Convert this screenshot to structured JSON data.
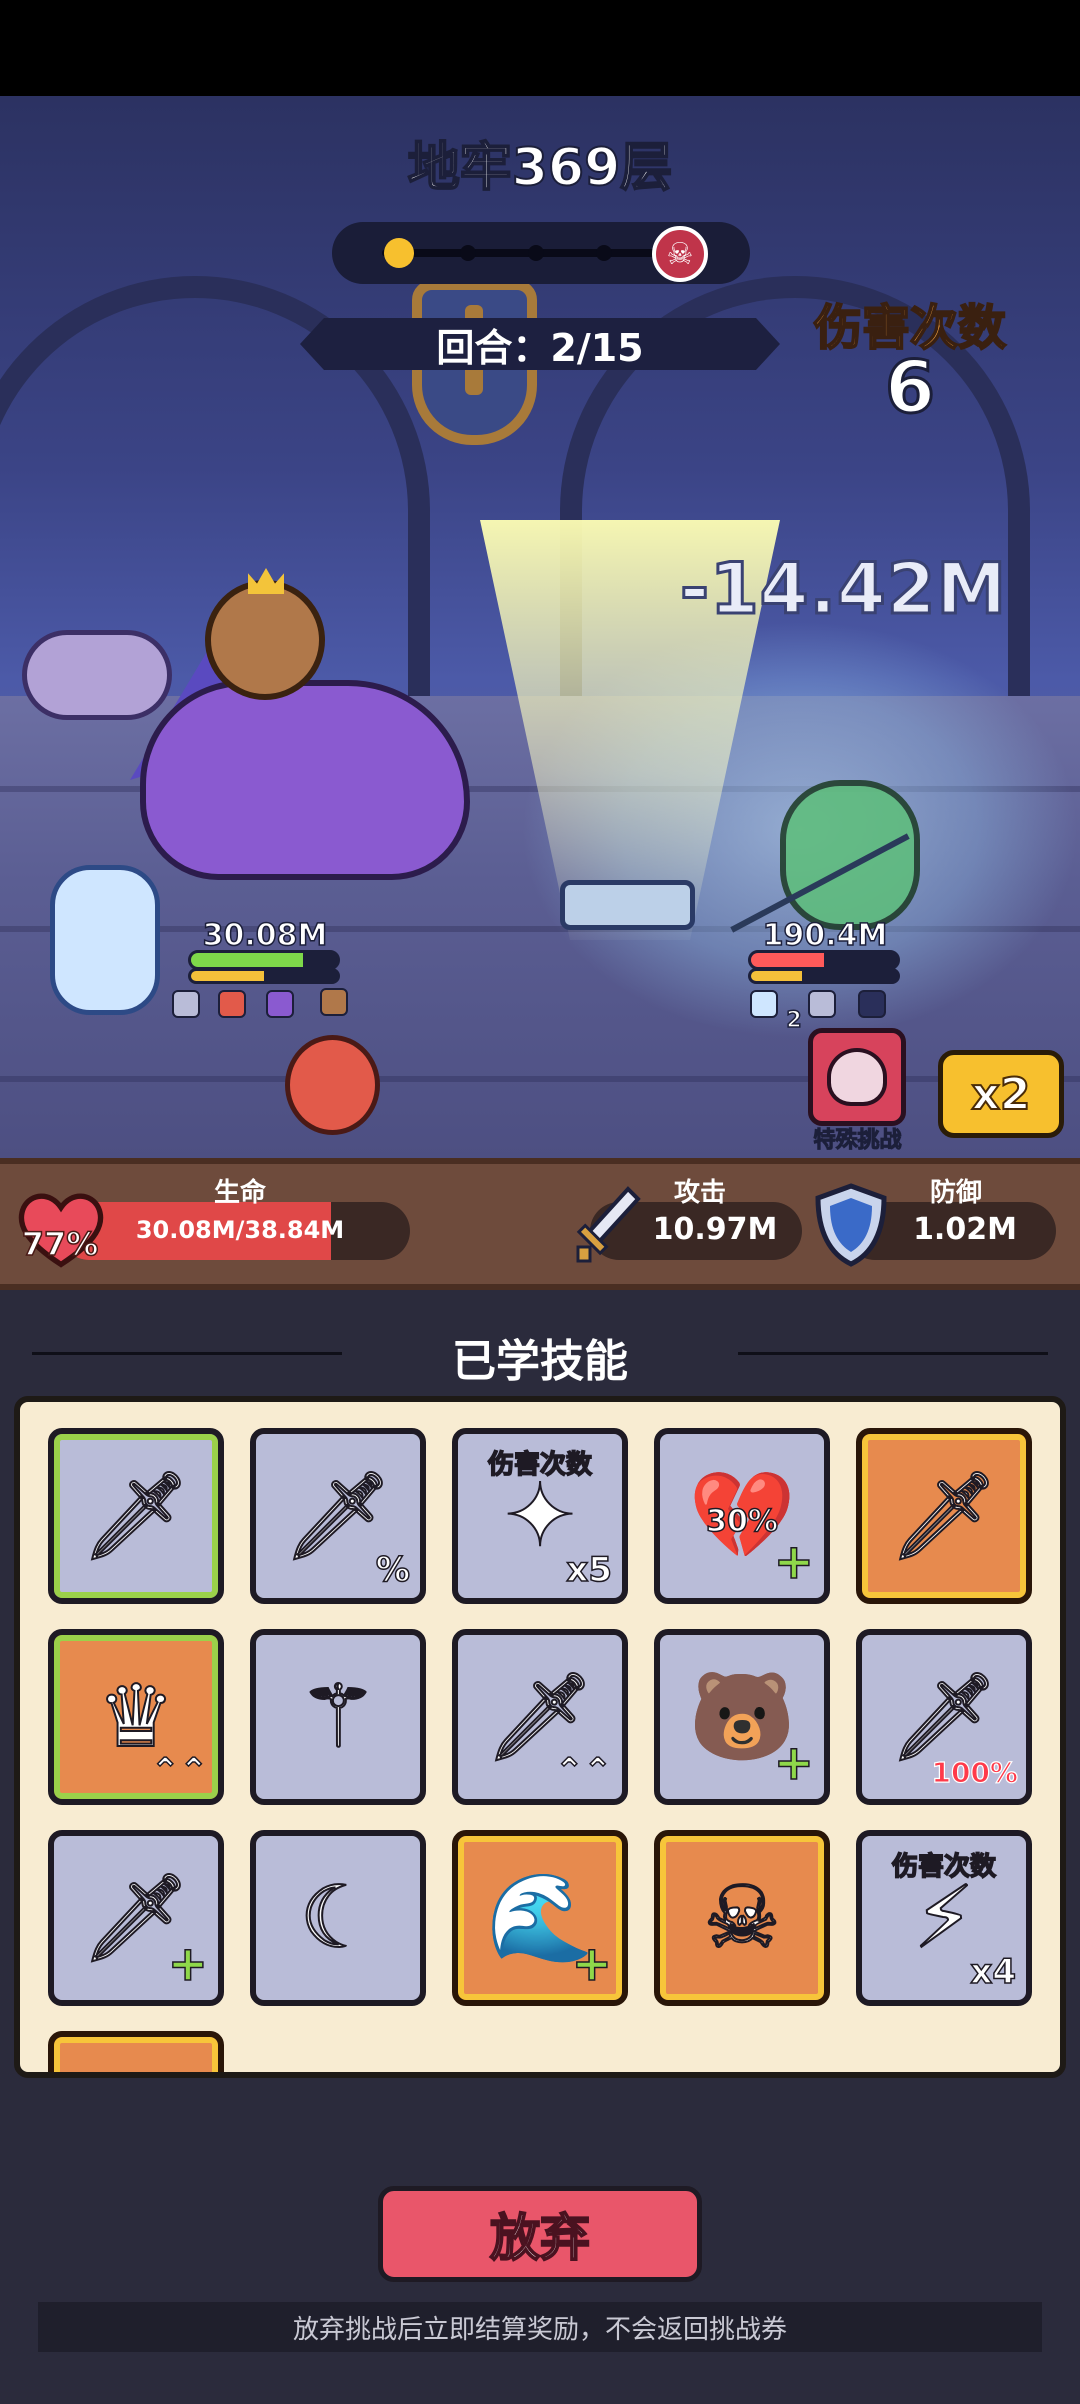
{
  "dungeon": {
    "title": "地牢369层",
    "stage_progress": {
      "current": 1,
      "total": 5
    },
    "round_text": "回合：2/15",
    "hit_count_label": "伤害次数",
    "hit_count_value": "6",
    "damage_popup": "-14.42M"
  },
  "player_unit": {
    "hp_text": "30.08M",
    "hp_fraction": 0.77,
    "mp_fraction": 0.5
  },
  "enemy_unit": {
    "hp_text": "190.4M",
    "hp_fraction": 0.5,
    "mp_fraction": 0.35,
    "buff_count": "2"
  },
  "special_challenge": {
    "label": "特殊挑战",
    "icon": "skull-icon"
  },
  "speed_button": {
    "label": "x2"
  },
  "stats": {
    "hp_label": "生命",
    "hp_value": "30.08M/38.84M",
    "hp_percent": "77%",
    "hp_fraction": 0.7745,
    "attack_label": "攻击",
    "attack_value": "10.97M",
    "defense_label": "防御",
    "defense_value": "1.02M"
  },
  "skills": {
    "title": "已学技能",
    "items": [
      {
        "icon": "ice-sword-icon",
        "glyph": "🗡",
        "style": "grey-green",
        "badge_top": "",
        "badge_br": ""
      },
      {
        "icon": "crit-sword-icon",
        "glyph": "🗡",
        "style": "common",
        "badge_top": "",
        "badge_br": "%"
      },
      {
        "icon": "ice-burst-icon",
        "glyph": "✦",
        "style": "common",
        "badge_top": "伤害次数",
        "badge_br": "x5"
      },
      {
        "icon": "broken-heart-icon",
        "glyph": "💔",
        "style": "common",
        "badge_top": "",
        "badge_mid": "30%",
        "badge_br": "+"
      },
      {
        "icon": "dash-sword-icon",
        "glyph": "🗡",
        "style": "rare",
        "badge_top": "",
        "badge_br": ""
      },
      {
        "icon": "crown-icon",
        "glyph": "♛",
        "style": "green",
        "badge_top": "",
        "badge_br": "⌃⌃"
      },
      {
        "icon": "golden-staff-icon",
        "glyph": "⚚",
        "style": "common",
        "badge_top": "",
        "badge_br": ""
      },
      {
        "icon": "flame-sword-icon",
        "glyph": "🗡",
        "style": "common",
        "badge_top": "",
        "badge_br": "⌃⌃"
      },
      {
        "icon": "capybara-icon",
        "glyph": "🐻",
        "style": "common",
        "badge_top": "",
        "badge_br": "+"
      },
      {
        "icon": "broken-sword-icon",
        "glyph": "🗡",
        "style": "common",
        "badge_top": "",
        "badge_red": "100%"
      },
      {
        "icon": "shadow-sword-icon",
        "glyph": "🗡",
        "style": "common",
        "badge_top": "",
        "badge_br": "+"
      },
      {
        "icon": "fire-crescent-icon",
        "glyph": "☾",
        "style": "common",
        "badge_top": "",
        "badge_br": ""
      },
      {
        "icon": "water-wave-icon",
        "glyph": "🌊",
        "style": "rare",
        "badge_top": "",
        "badge_br": "+"
      },
      {
        "icon": "skull-ice-icon",
        "glyph": "☠",
        "style": "rare",
        "badge_top": "",
        "badge_br": ""
      },
      {
        "icon": "lightning-icon",
        "glyph": "⚡",
        "style": "common",
        "badge_top": "伤害次数",
        "badge_br": "x4"
      },
      {
        "icon": "partial-skill-icon",
        "glyph": "",
        "style": "rare",
        "badge_top": "",
        "badge_br": ""
      }
    ]
  },
  "actions": {
    "give_up_label": "放弃",
    "notice": "放弃挑战后立即结算奖励，不会返回挑战券"
  },
  "colors": {
    "accent_orange": "#f5a342",
    "hp_red": "#e04848",
    "give_up_red": "#e9566a",
    "speed_yellow": "#f7c02e",
    "skill_panel": "#f8ecd2"
  }
}
